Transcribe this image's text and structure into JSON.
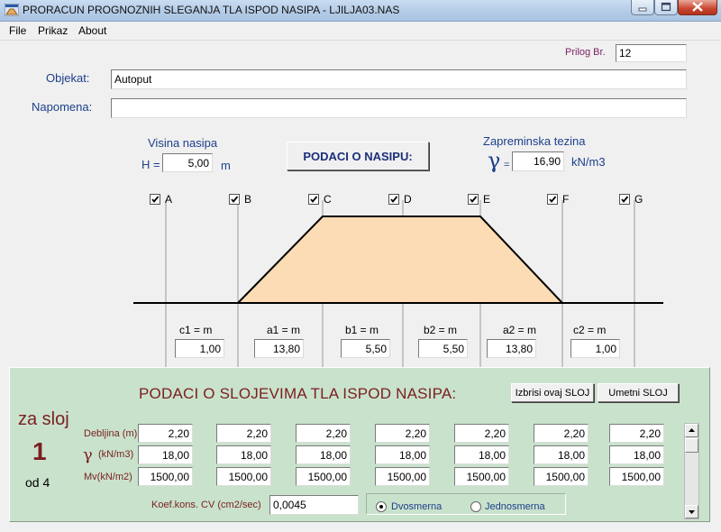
{
  "window": {
    "title": "PRORACUN PROGNOZNIH SLEGANJA TLA ISPOD NASIPA  -     LJILJA03.NAS"
  },
  "menu": {
    "items": [
      "File",
      "Prikaz",
      "About"
    ]
  },
  "header": {
    "prilog_label": "Prilog Br.",
    "prilog_value": "12",
    "objekat_label": "Objekat:",
    "objekat_value": "Autoput",
    "napomena_label": "Napomena:",
    "napomena_value": ""
  },
  "embankment": {
    "visina_label": "Visina nasipa",
    "h_label": "H =",
    "h_value": "5,00",
    "h_unit": "m",
    "button_label": "PODACI O NASIPU:",
    "zapreminska_label": "Zapreminska tezina",
    "gamma_symbol": "γ",
    "gamma_eq": "=",
    "gamma_value": "16,90",
    "gamma_unit": "kN/m3",
    "fill_color": "#fcdcb4",
    "checkpoints": [
      {
        "label": "A",
        "checked": true
      },
      {
        "label": "B",
        "checked": true
      },
      {
        "label": "C",
        "checked": true
      },
      {
        "label": "D",
        "checked": true
      },
      {
        "label": "E",
        "checked": true
      },
      {
        "label": "F",
        "checked": true
      },
      {
        "label": "G",
        "checked": true
      }
    ],
    "segments": [
      {
        "label": "c1 = m",
        "value": "1,00"
      },
      {
        "label": "a1 = m",
        "value": "13,80"
      },
      {
        "label": "b1 = m",
        "value": "5,50"
      },
      {
        "label": "b2 = m",
        "value": "5,50"
      },
      {
        "label": "a2 = m",
        "value": "13,80"
      },
      {
        "label": "c2 = m",
        "value": "1,00"
      }
    ]
  },
  "layers": {
    "panel_color": "#c9e2cc",
    "title": "PODACI O SLOJEVIMA TLA ISPOD NASIPA:",
    "delete_button": "Izbrisi ovaj SLOJ",
    "insert_button": "Umetni SLOJ",
    "za_sloj": "za sloj",
    "layer_number": "1",
    "od_text": "od  4",
    "row_labels": {
      "debljina": "Debljina (m)",
      "gamma_symbol": "γ",
      "gamma_unit": "(kN/m3)",
      "mv": "Mv(kN/m2)"
    },
    "debljina_values": [
      "2,20",
      "2,20",
      "2,20",
      "2,20",
      "2,20",
      "2,20",
      "2,20"
    ],
    "gamma_values": [
      "18,00",
      "18,00",
      "18,00",
      "18,00",
      "18,00",
      "18,00",
      "18,00"
    ],
    "mv_values": [
      "1500,00",
      "1500,00",
      "1500,00",
      "1500,00",
      "1500,00",
      "1500,00",
      "1500,00"
    ],
    "cv_label": "Koef.kons.  CV (cm2/sec)",
    "cv_value": "0,0045",
    "radio_options": [
      {
        "label": "Dvosmerna",
        "selected": true
      },
      {
        "label": "Jednosmerna",
        "selected": false
      }
    ]
  }
}
